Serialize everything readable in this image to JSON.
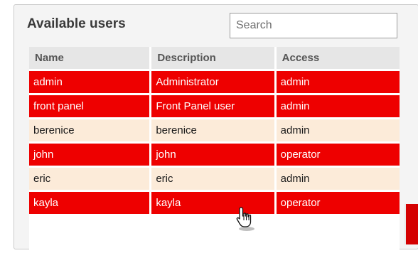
{
  "panel": {
    "title": "Available users"
  },
  "search": {
    "placeholder": "Search",
    "value": ""
  },
  "table": {
    "columns": [
      "Name",
      "Description",
      "Access"
    ],
    "rows": [
      {
        "name": "admin",
        "description": "Administrator",
        "access": "admin",
        "selected": true
      },
      {
        "name": "front panel",
        "description": "Front Panel user",
        "access": "admin",
        "selected": true
      },
      {
        "name": "berenice",
        "description": "berenice",
        "access": "admin",
        "selected": false
      },
      {
        "name": "john",
        "description": "john",
        "access": "operator",
        "selected": true
      },
      {
        "name": "eric",
        "description": "eric",
        "access": "admin",
        "selected": false
      },
      {
        "name": "kayla",
        "description": "kayla",
        "access": "operator",
        "selected": true
      }
    ]
  },
  "colors": {
    "selected_row": "#ee0000",
    "unselected_row": "#fcebd9",
    "header": "#e6e6e6"
  },
  "cursor": {
    "icon": "hand-pointer-icon"
  }
}
